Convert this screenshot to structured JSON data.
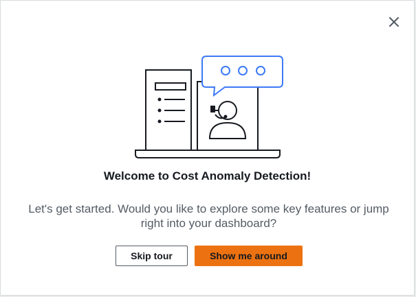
{
  "modal": {
    "title": "Welcome to Cost Anomaly Detection!",
    "description": "Let's get started. Would you like to explore some key features or jump right into your dashboard?",
    "skip_label": "Skip tour",
    "primary_label": "Show me around",
    "close_icon": "close-icon",
    "illustration_icon": "support-agent-laptop-illustration"
  },
  "colors": {
    "primary_button": "#ec7211",
    "accent_blue": "#3b79f6",
    "ink": "#16191f",
    "muted_text": "#545b64"
  }
}
